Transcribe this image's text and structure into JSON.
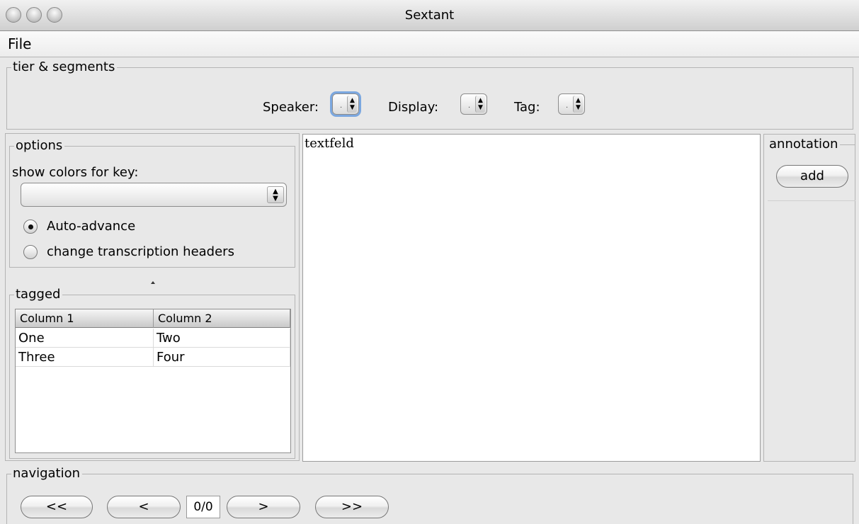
{
  "window": {
    "title": "Sextant"
  },
  "menu": {
    "file": "File"
  },
  "tier": {
    "legend": "tier & segments",
    "speaker_label": "Speaker:",
    "display_label": "Display:",
    "tag_label": "Tag:",
    "speaker_value": ".",
    "display_value": ".",
    "tag_value": "."
  },
  "options": {
    "legend": "options",
    "colors_label": "show colors for key:",
    "colors_value": "",
    "auto_advance_label": "Auto-advance",
    "change_headers_label": "change transcription headers",
    "auto_advance_selected": true,
    "change_headers_selected": false
  },
  "tagged": {
    "legend": "tagged",
    "columns": [
      "Column 1",
      "Column 2"
    ],
    "rows": [
      [
        "One",
        "Two"
      ],
      [
        "Three",
        "Four"
      ]
    ]
  },
  "editor": {
    "text": "textfeld"
  },
  "annotation": {
    "legend": "annotation",
    "add_label": "add"
  },
  "navigation": {
    "legend": "navigation",
    "first_label": "<<",
    "prev_label": "<",
    "page_indicator": "0/0",
    "next_label": ">",
    "last_label": ">>"
  },
  "icons": {
    "window_controls": [
      "close-icon",
      "minimize-icon",
      "zoom-icon"
    ],
    "spinner": "up-down-arrows-icon",
    "divider": "split-pane-grip-icon"
  }
}
